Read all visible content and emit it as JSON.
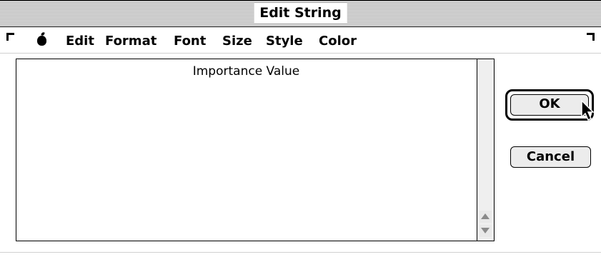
{
  "window": {
    "title": "Edit String"
  },
  "menubar": {
    "items": [
      {
        "label": "Edit"
      },
      {
        "label": "Format"
      },
      {
        "label": "Font"
      },
      {
        "label": "Size"
      },
      {
        "label": "Style"
      },
      {
        "label": "Color"
      }
    ]
  },
  "editor": {
    "text": "Importance Value"
  },
  "buttons": {
    "ok_label": "OK",
    "cancel_label": "Cancel"
  }
}
